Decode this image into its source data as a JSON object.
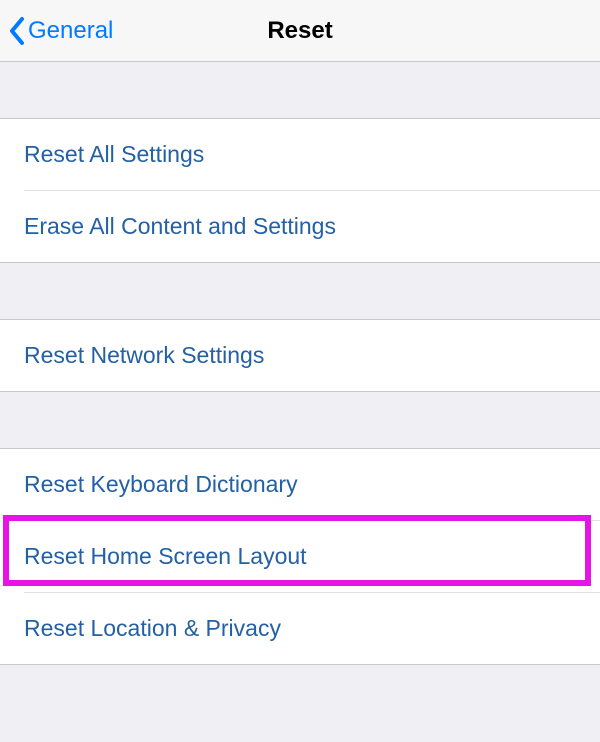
{
  "nav": {
    "back_label": "General",
    "title": "Reset"
  },
  "groups": [
    {
      "items": [
        {
          "label": "Reset All Settings"
        },
        {
          "label": "Erase All Content and Settings"
        }
      ]
    },
    {
      "items": [
        {
          "label": "Reset Network Settings"
        }
      ]
    },
    {
      "items": [
        {
          "label": "Reset Keyboard Dictionary"
        },
        {
          "label": "Reset Home Screen Layout",
          "highlighted": true
        },
        {
          "label": "Reset Location & Privacy"
        }
      ]
    }
  ]
}
